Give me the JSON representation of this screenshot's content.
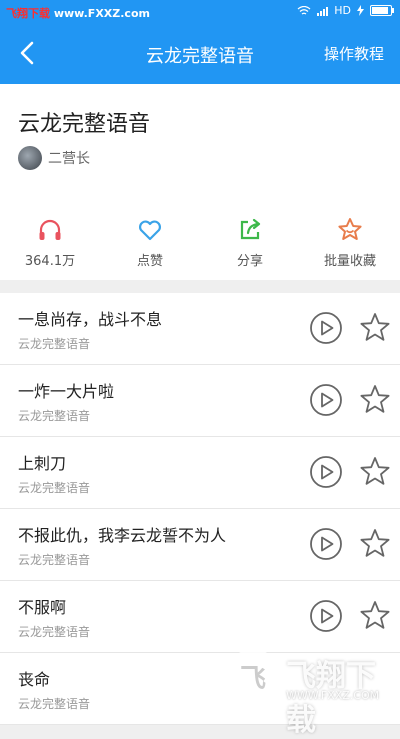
{
  "statusbar": {
    "watermark_red": "飞翔下载",
    "watermark_white": "www.FXXZ.com",
    "network": "HD"
  },
  "nav": {
    "title": "云龙完整语音",
    "tutorial": "操作教程"
  },
  "info": {
    "title": "云龙完整语音",
    "author": "二营长"
  },
  "stats": {
    "plays": "364.1万",
    "like": "点赞",
    "share": "分享",
    "collect": "批量收藏"
  },
  "items": [
    {
      "title": "一息尚存，战斗不息",
      "sub": "云龙完整语音"
    },
    {
      "title": "一炸一大片啦",
      "sub": "云龙完整语音"
    },
    {
      "title": "上刺刀",
      "sub": "云龙完整语音"
    },
    {
      "title": "不报此仇，我李云龙誓不为人",
      "sub": "云龙完整语音"
    },
    {
      "title": "不服啊",
      "sub": "云龙完整语音"
    },
    {
      "title": "丧命",
      "sub": "云龙完整语音"
    }
  ],
  "brand": {
    "name": "飞翔下载",
    "url": "WWW.FXXZ.COM"
  },
  "colors": {
    "primary": "#2196f3",
    "headphone": "#e9535e",
    "heart": "#3aa3e8",
    "share": "#3db84a",
    "star": "#e87d4c"
  }
}
